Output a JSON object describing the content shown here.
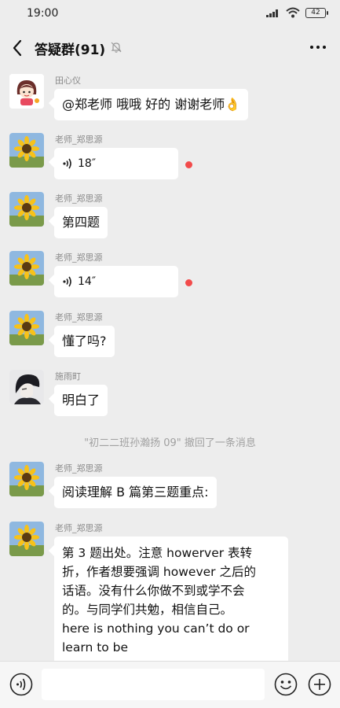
{
  "status": {
    "time": "19:00",
    "battery": "42"
  },
  "header": {
    "title": "答疑群(91)"
  },
  "messages": [
    {
      "sender": "田心仪",
      "text": "@郑老师  哦哦 好的 谢谢老师👌"
    },
    {
      "sender": "老师_郑思源",
      "voice": "18″"
    },
    {
      "sender": "老师_郑思源",
      "text": "第四题"
    },
    {
      "sender": "老师_郑思源",
      "voice": "14″"
    },
    {
      "sender": "老师_郑思源",
      "text": "懂了吗?"
    },
    {
      "sender": "施雨町",
      "text": "明白了"
    },
    {
      "sender": "老师_郑思源",
      "text": "阅读理解 B 篇第三题重点:"
    },
    {
      "sender": "老师_郑思源",
      "lines": [
        "第 3 题出处。注意 howerver 表转",
        "折，作者想要强调 however 之后的",
        "话语。没有什么你做不到或学不会",
        "的。与同学们共勉，相信自己。",
        "here is nothing you can’t do or",
        "learn to be"
      ]
    }
  ],
  "system_notice": "\"初二二班孙瀚扬 09\" 撤回了一条消息",
  "colors": {
    "background": "#ededed",
    "bubble": "#ffffff",
    "unread": "#f24b4b"
  }
}
